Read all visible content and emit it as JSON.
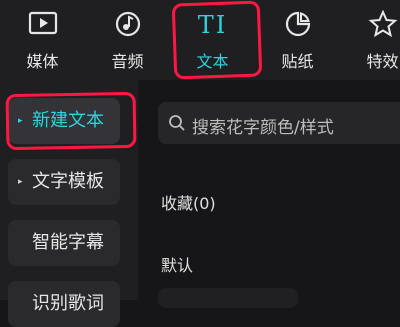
{
  "tabs": [
    {
      "label": "媒体",
      "icon": "media-play-icon"
    },
    {
      "label": "音频",
      "icon": "music-note-icon"
    },
    {
      "label": "文本",
      "icon": "text-ti-icon",
      "glyph": "TI",
      "active": true
    },
    {
      "label": "贴纸",
      "icon": "sticker-icon"
    },
    {
      "label": "特效",
      "icon": "star-effect-icon"
    }
  ],
  "sidebar": {
    "items": [
      {
        "label": "新建文本",
        "arrow": "▸",
        "active": true
      },
      {
        "label": "文字模板",
        "arrow": "▸"
      },
      {
        "label": "智能字幕"
      },
      {
        "label": "识别歌词"
      }
    ]
  },
  "search": {
    "placeholder": "搜索花字颜色/样式"
  },
  "sections": {
    "favorites": "收藏(0)",
    "default": "默认"
  },
  "colors": {
    "accent": "#2ed3de",
    "highlight": "#ff1744",
    "background": "#161618",
    "panel": "#1f1f22"
  }
}
